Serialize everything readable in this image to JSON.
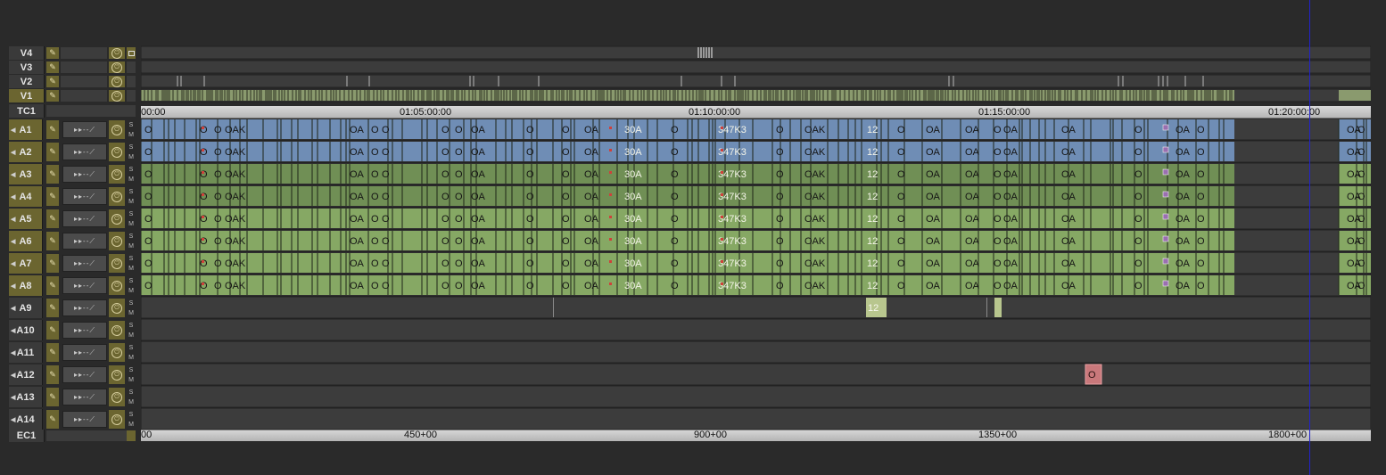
{
  "tracks": {
    "video": [
      {
        "label": "V4",
        "selected": false
      },
      {
        "label": "V3",
        "selected": false
      },
      {
        "label": "V2",
        "selected": false
      },
      {
        "label": "V1",
        "selected": true
      }
    ],
    "timecode_track": {
      "label": "TC1"
    },
    "audio": [
      {
        "label": "A1",
        "selected": true
      },
      {
        "label": "A2",
        "selected": true
      },
      {
        "label": "A3",
        "selected": true
      },
      {
        "label": "A4",
        "selected": true
      },
      {
        "label": "A5",
        "selected": true
      },
      {
        "label": "A6",
        "selected": true
      },
      {
        "label": "A7",
        "selected": true
      },
      {
        "label": "A8",
        "selected": true
      },
      {
        "label": "A9",
        "selected": false
      },
      {
        "label": "A10",
        "selected": false
      },
      {
        "label": "A11",
        "selected": false
      },
      {
        "label": "A12",
        "selected": false
      },
      {
        "label": "A13",
        "selected": false
      },
      {
        "label": "A14",
        "selected": false
      }
    ],
    "edgecode_track": {
      "label": "EC1"
    }
  },
  "timecode_ruler": {
    "labels": [
      "00:00",
      "01:05:00:00",
      "01:10:00:00",
      "01:15:00:00",
      "01:20:00:00"
    ]
  },
  "edgecode_ruler": {
    "labels": [
      "00",
      "450+00",
      "900+00",
      "1350+00",
      "1800+00"
    ]
  },
  "track_buttons": {
    "solo": "S",
    "mute": "M"
  },
  "clip_labels": {
    "main": "OAK",
    "short": "OA",
    "tiny": "O",
    "mid_a": "30A",
    "mid_b": "347K3",
    "mid_c": "12",
    "a12_clip": "O"
  },
  "colors": {
    "v_clip": "#8a9a6e",
    "a_stereo_clip": "#6f8db5",
    "a_mono_clip": "#86a864",
    "a_mono_dark": "#5f7a48",
    "a12_clip": "#c9787b",
    "track_bg": "#3c3c3c",
    "header_selected": "#6b6530",
    "playhead": "#2222cc"
  },
  "icons": {
    "speaker": "speaker-icon",
    "pencil": "pencil-icon",
    "waveform": "waveform-icon",
    "power": "power-icon",
    "monitor": "monitor-icon"
  }
}
